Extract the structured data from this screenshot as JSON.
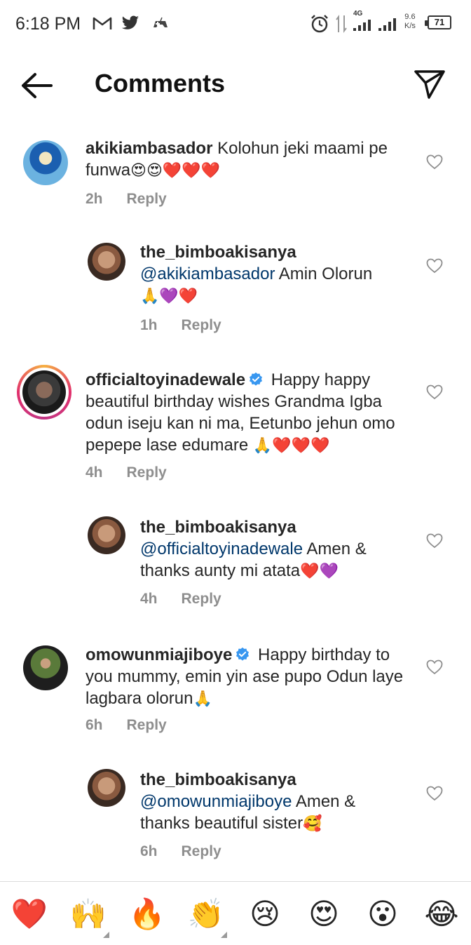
{
  "status_bar": {
    "time": "6:18 PM",
    "network_label": "4G",
    "speed_value": "9.6",
    "speed_unit": "K/s",
    "battery": "71",
    "icons": [
      "gmail-icon",
      "twitter-icon",
      "game-controller-icon",
      "alarm-icon",
      "data-arrows-icon",
      "signal-icon",
      "signal-icon-2"
    ]
  },
  "header": {
    "title": "Comments",
    "back_icon": "arrow-left-icon",
    "share_icon": "paper-plane-icon"
  },
  "comments": [
    {
      "username": "akikiambasador",
      "text": "Kolohun  jeki maami pe funwa",
      "emojis": "😍😍❤️❤️❤️",
      "time": "2h",
      "reply_label": "Reply",
      "is_reply": false,
      "verified": false,
      "avatar_colors": [
        "#6bb2e0",
        "#1b5fb0",
        "#f2e6c0"
      ]
    },
    {
      "username": "the_bimboakisanya",
      "mention": "@akikiambasador",
      "text": " Amin Olorun",
      "emojis": "🙏💜❤️",
      "time": "1h",
      "reply_label": "Reply",
      "is_reply": true,
      "verified": false,
      "avatar_colors": [
        "#3a2a22",
        "#c89a7a",
        "#8a5a40"
      ]
    },
    {
      "username": "officialtoyinadewale",
      "text": " Happy happy beautiful birthday wishes Grandma Igba odun iseju kan ni ma, Eetunbo jehun omo pepepe lase edumare ",
      "emojis": "🙏❤️❤️❤️",
      "time": "4h",
      "reply_label": "Reply",
      "is_reply": false,
      "verified": true,
      "avatar_colors": [
        "#1a1a1a",
        "#8a6a5a",
        "#3a3a3a"
      ]
    },
    {
      "username": "the_bimboakisanya",
      "mention": "@officialtoyinadewale",
      "text": " Amen & thanks aunty mi atata",
      "emojis": "❤️💜",
      "time": "4h",
      "reply_label": "Reply",
      "is_reply": true,
      "verified": false,
      "avatar_colors": [
        "#3a2a22",
        "#c89a7a",
        "#8a5a40"
      ]
    },
    {
      "username": "omowunmiajiboye",
      "text": " Happy birthday to you mummy, emin yin ase pupo Odun laye lagbara olorun",
      "emojis": "🙏",
      "time": "6h",
      "reply_label": "Reply",
      "is_reply": false,
      "verified": true,
      "avatar_colors": [
        "#1e1e1e",
        "#5a7a3a",
        "#2a2a2a"
      ]
    },
    {
      "username": "the_bimboakisanya",
      "mention": "@omowunmiajiboye",
      "text": " Amen & thanks beautiful sister",
      "emojis": "🥰",
      "time": "6h",
      "reply_label": "Reply",
      "is_reply": true,
      "verified": false,
      "avatar_colors": [
        "#3a2a22",
        "#c89a7a",
        "#8a5a40"
      ]
    }
  ],
  "emoji_bar": [
    {
      "emoji": "❤️",
      "name": "red-heart-emoji"
    },
    {
      "emoji": "🙌",
      "name": "raising-hands-emoji"
    },
    {
      "emoji": "🔥",
      "name": "fire-emoji"
    },
    {
      "emoji": "👏",
      "name": "clapping-hands-emoji"
    },
    {
      "emoji": "😢",
      "name": "crying-face-emoji"
    },
    {
      "emoji": "😍",
      "name": "heart-eyes-emoji"
    },
    {
      "emoji": "😮",
      "name": "surprised-face-emoji"
    },
    {
      "emoji": "😂",
      "name": "tears-of-joy-emoji"
    }
  ],
  "colors": {
    "text": "#262626",
    "meta": "#8e8e8e",
    "mention": "#00376b",
    "verified": "#3897f0"
  }
}
